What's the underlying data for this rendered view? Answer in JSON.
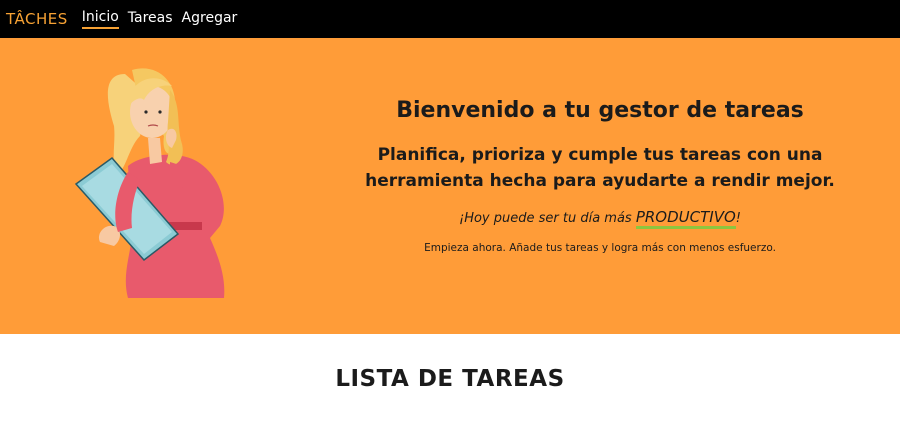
{
  "navbar": {
    "brand": "TÂCHES",
    "links": [
      {
        "label": "Inicio",
        "active": true
      },
      {
        "label": "Tareas",
        "active": false
      },
      {
        "label": "Agregar",
        "active": false
      }
    ]
  },
  "hero": {
    "title": "Bienvenido a tu gestor de tareas",
    "subtitle_line1": "Planifica, prioriza y cumple tus tareas con una",
    "subtitle_line2": "herramienta hecha para ayudarte a rendir mejor.",
    "tagline_prefix": "¡Hoy puede ser tu día más ",
    "tagline_highlight": "PRODUCTIVO",
    "tagline_suffix": "!",
    "cta": "Empieza ahora. Añade tus tareas y logra más con menos esfuerzo."
  },
  "tasks_section": {
    "title": "LISTA DE TAREAS"
  },
  "colors": {
    "accent": "#f7a234",
    "hero_bg": "#ff9c38",
    "navbar_bg": "#000000",
    "highlight_underline": "#8cc63f"
  }
}
